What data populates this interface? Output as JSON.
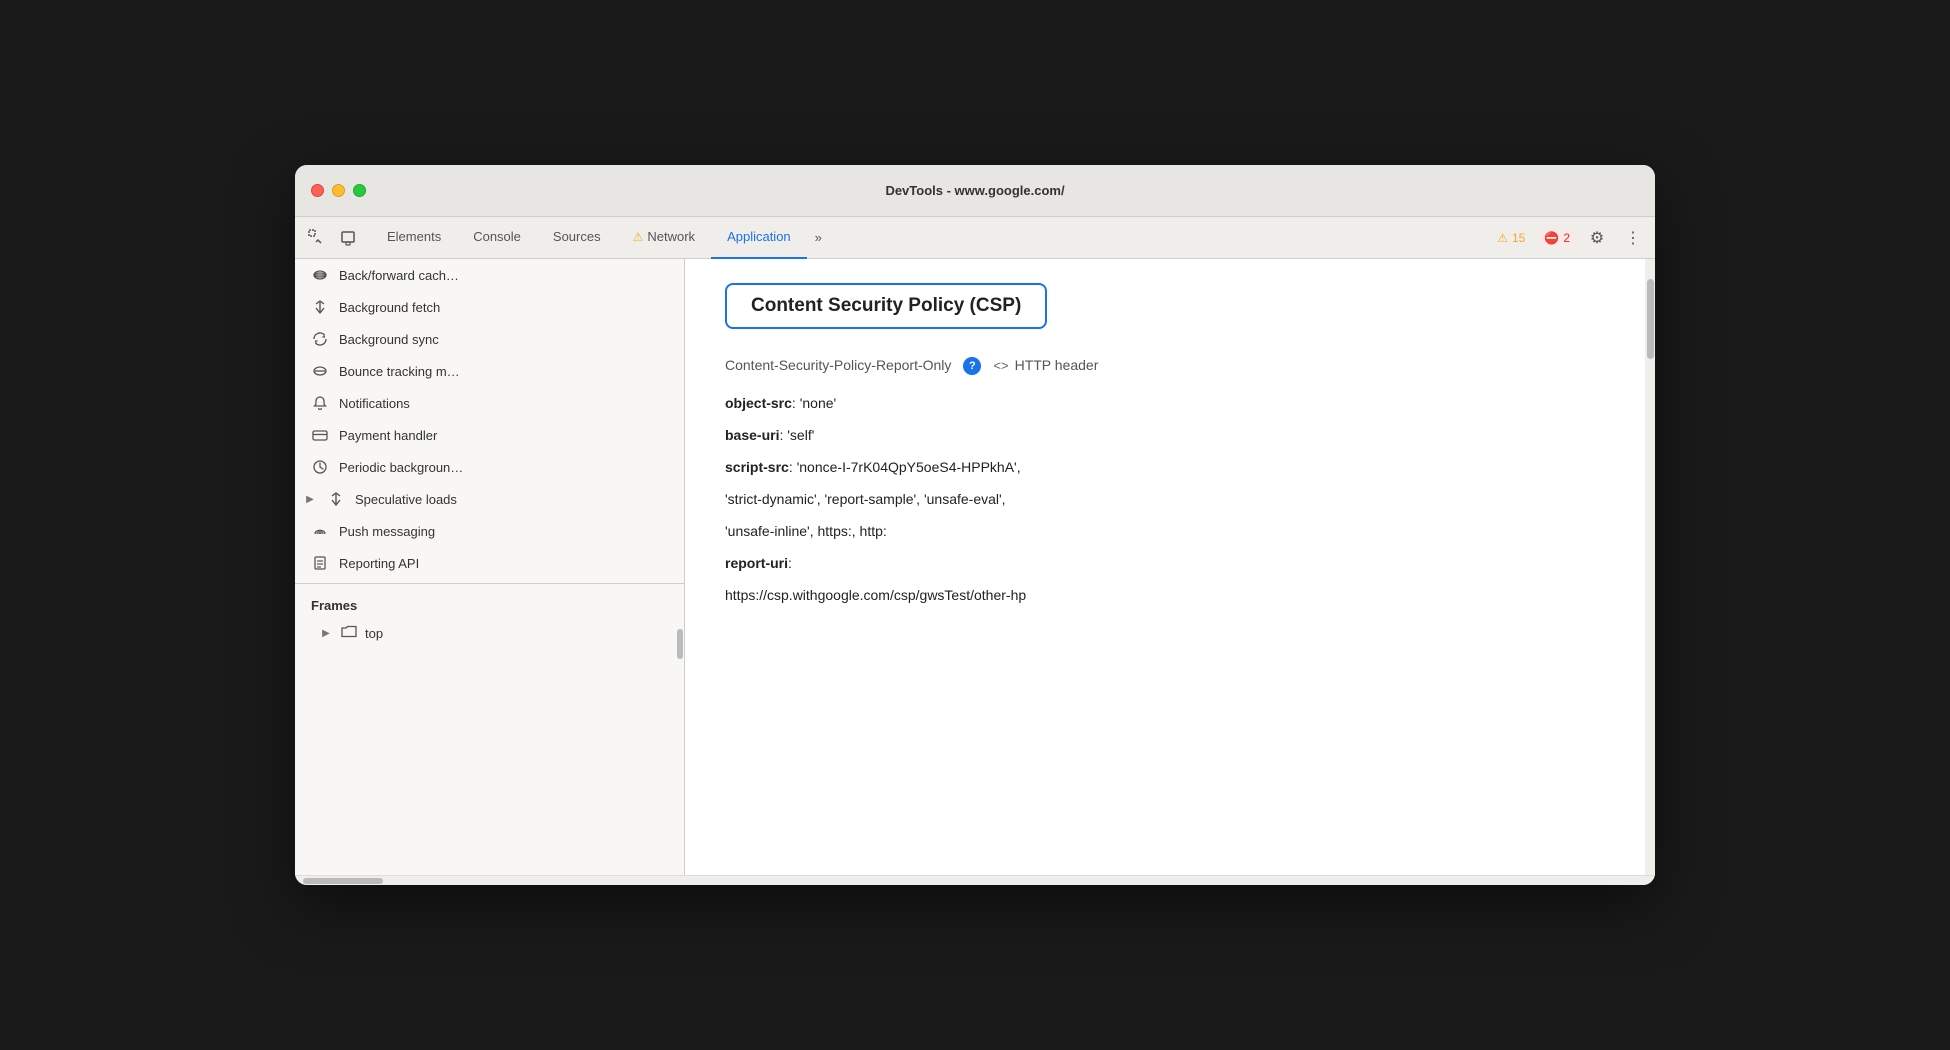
{
  "window": {
    "title": "DevTools - www.google.com/"
  },
  "tabs_icons": [
    {
      "name": "inspect-icon",
      "symbol": "⊹"
    },
    {
      "name": "device-icon",
      "symbol": "⬜"
    }
  ],
  "tabs": [
    {
      "label": "Elements",
      "active": false,
      "warning": false
    },
    {
      "label": "Console",
      "active": false,
      "warning": false
    },
    {
      "label": "Sources",
      "active": false,
      "warning": false
    },
    {
      "label": "Network",
      "active": false,
      "warning": true
    },
    {
      "label": "Application",
      "active": true,
      "warning": false
    }
  ],
  "tab_more": "»",
  "toolbar_right": {
    "warning_count": "15",
    "error_count": "2",
    "settings_label": "⚙",
    "more_label": "⋮"
  },
  "sidebar": {
    "items": [
      {
        "icon": "cylinder-icon",
        "symbol": "🗄",
        "label": "Back/forward cach",
        "truncated": true
      },
      {
        "icon": "bg-fetch-icon",
        "symbol": "↕",
        "label": "Background fetch"
      },
      {
        "icon": "bg-sync-icon",
        "symbol": "↻",
        "label": "Background sync"
      },
      {
        "icon": "bounce-icon",
        "symbol": "🗄",
        "label": "Bounce tracking m",
        "truncated": true
      },
      {
        "icon": "notif-icon",
        "symbol": "🔔",
        "label": "Notifications"
      },
      {
        "icon": "payment-icon",
        "symbol": "💳",
        "label": "Payment handler"
      },
      {
        "icon": "periodic-icon",
        "symbol": "⏱",
        "label": "Periodic backgroun",
        "truncated": true
      },
      {
        "icon": "speculative-icon",
        "symbol": "↕",
        "label": "Speculative loads",
        "has_arrow": true
      },
      {
        "icon": "push-icon",
        "symbol": "☁",
        "label": "Push messaging"
      },
      {
        "icon": "reporting-icon",
        "symbol": "📄",
        "label": "Reporting API"
      }
    ],
    "frames_header": "Frames",
    "frames_top": "top"
  },
  "main": {
    "csp_title": "Content Security Policy (CSP)",
    "policy_label": "Content-Security-Policy-Report-Only",
    "http_header": "<> HTTP header",
    "directives": [
      {
        "key": "object-src",
        "value": ": 'none'"
      },
      {
        "key": "base-uri",
        "value": ": 'self'"
      },
      {
        "key": "script-src",
        "value": ": 'nonce-I-7rK04QpY5oeS4-HPPkhA',"
      },
      {
        "key": "",
        "value": "'strict-dynamic', 'report-sample', 'unsafe-eval',"
      },
      {
        "key": "",
        "value": "'unsafe-inline', https:, http:"
      },
      {
        "key": "report-uri",
        "value": ":"
      },
      {
        "key": "",
        "value": "https://csp.withgoogle.com/csp/gwsTest/other-hp"
      }
    ]
  }
}
